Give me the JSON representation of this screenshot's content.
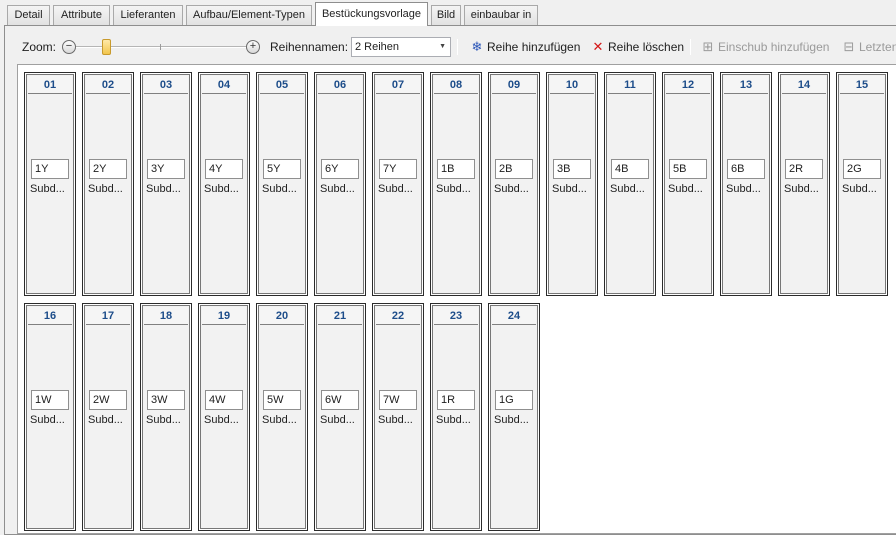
{
  "tabs": [
    {
      "label": "Detail",
      "active": false
    },
    {
      "label": "Attribute",
      "active": false
    },
    {
      "label": "Lieferanten",
      "active": false
    },
    {
      "label": "Aufbau/Element-Typen",
      "active": false
    },
    {
      "label": "Bestückungsvorlage",
      "active": true
    },
    {
      "label": "Bild",
      "active": false
    },
    {
      "label": "einbaubar in",
      "active": false
    }
  ],
  "toolbar": {
    "zoom_label": "Zoom:",
    "zoom_minus": "−",
    "zoom_plus": "+",
    "rows_label": "Reihennamen:",
    "rows_value": "2 Reihen",
    "add_row": "Reihe hinzufügen",
    "delete_row": "Reihe löschen",
    "add_slot": "Einschub hinzufügen",
    "last": "Letzten"
  },
  "icons": {
    "add_row": "snowflake-icon",
    "delete_row": "red-x-icon",
    "add_slot": "insert-slot-icon",
    "last": "delete-last-icon"
  },
  "colors": {
    "slot_number": "#1d4d8a",
    "delete_icon": "#d41717",
    "add_icon": "#2a55b8"
  },
  "slots": [
    {
      "num": "01",
      "code": "1Y",
      "sub": "Subd..."
    },
    {
      "num": "02",
      "code": "2Y",
      "sub": "Subd..."
    },
    {
      "num": "03",
      "code": "3Y",
      "sub": "Subd..."
    },
    {
      "num": "04",
      "code": "4Y",
      "sub": "Subd..."
    },
    {
      "num": "05",
      "code": "5Y",
      "sub": "Subd..."
    },
    {
      "num": "06",
      "code": "6Y",
      "sub": "Subd..."
    },
    {
      "num": "07",
      "code": "7Y",
      "sub": "Subd..."
    },
    {
      "num": "08",
      "code": "1B",
      "sub": "Subd..."
    },
    {
      "num": "09",
      "code": "2B",
      "sub": "Subd..."
    },
    {
      "num": "10",
      "code": "3B",
      "sub": "Subd..."
    },
    {
      "num": "11",
      "code": "4B",
      "sub": "Subd..."
    },
    {
      "num": "12",
      "code": "5B",
      "sub": "Subd..."
    },
    {
      "num": "13",
      "code": "6B",
      "sub": "Subd..."
    },
    {
      "num": "14",
      "code": "2R",
      "sub": "Subd..."
    },
    {
      "num": "15",
      "code": "2G",
      "sub": "Subd..."
    },
    {
      "num": "16",
      "code": "1W",
      "sub": "Subd..."
    },
    {
      "num": "17",
      "code": "2W",
      "sub": "Subd..."
    },
    {
      "num": "18",
      "code": "3W",
      "sub": "Subd..."
    },
    {
      "num": "19",
      "code": "4W",
      "sub": "Subd..."
    },
    {
      "num": "20",
      "code": "5W",
      "sub": "Subd..."
    },
    {
      "num": "21",
      "code": "6W",
      "sub": "Subd..."
    },
    {
      "num": "22",
      "code": "7W",
      "sub": "Subd..."
    },
    {
      "num": "23",
      "code": "1R",
      "sub": "Subd..."
    },
    {
      "num": "24",
      "code": "1G",
      "sub": "Subd..."
    }
  ]
}
